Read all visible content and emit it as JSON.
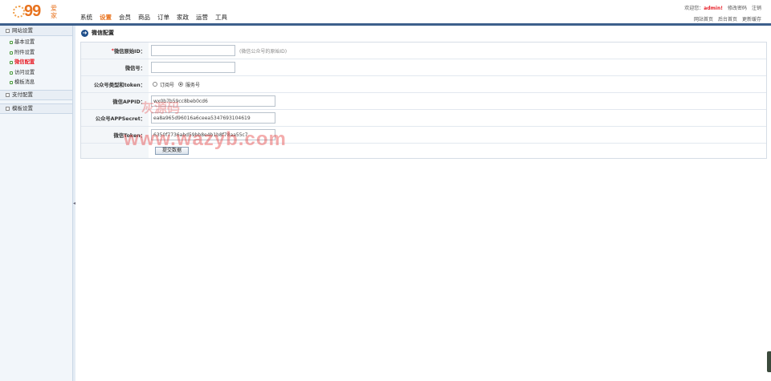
{
  "logo": {
    "number": "99",
    "cn": "爱家"
  },
  "nav": [
    "系统",
    "设置",
    "会员",
    "商品",
    "订单",
    "家政",
    "运营",
    "工具"
  ],
  "nav_active_index": 1,
  "toplinks": {
    "welcome": "欢迎您：",
    "user": "admin!",
    "change_password": "修改密码",
    "logout": "注销",
    "site_home": "网站首页",
    "admin_home": "后台首页",
    "update_cache": "更新缓存"
  },
  "sidebar": {
    "groups": [
      {
        "label": "网站设置",
        "items": [
          "基本设置",
          "附件设置",
          "微信配置",
          "访问设置",
          "模板消息"
        ],
        "current": 2
      },
      {
        "label": "支付配置",
        "items": []
      },
      {
        "label": "模板设置",
        "items": []
      }
    ]
  },
  "page_title": "微信配置",
  "form": {
    "wechat_id_label": "微信原始ID：",
    "wechat_id_value": "",
    "wechat_id_hint": "(微信公众号的原始ID)",
    "wechat_no_label": "微信号：",
    "wechat_no_value": "",
    "type_label": "公众号类型和token：",
    "type_options": [
      "订阅号",
      "服务号"
    ],
    "type_selected": 1,
    "appid_label": "微信APPID：",
    "appid_value": "wx0b7b59cc8beb0cd6",
    "secret_label": "公众号APPSecret：",
    "secret_value": "ea8a965d96016a6ceea5347693104619",
    "token_label": "微信Token：",
    "token_value": "6350f7736abd59bb8e4b1b8f78aa55c7",
    "submit_label": "提交数据"
  },
  "watermark": {
    "cn": "灰源码",
    "url": "www.wazyb.com"
  },
  "colors": {
    "accent": "#e8731f",
    "nav_bar": "#3d5f8c",
    "required": "#e8222b"
  }
}
